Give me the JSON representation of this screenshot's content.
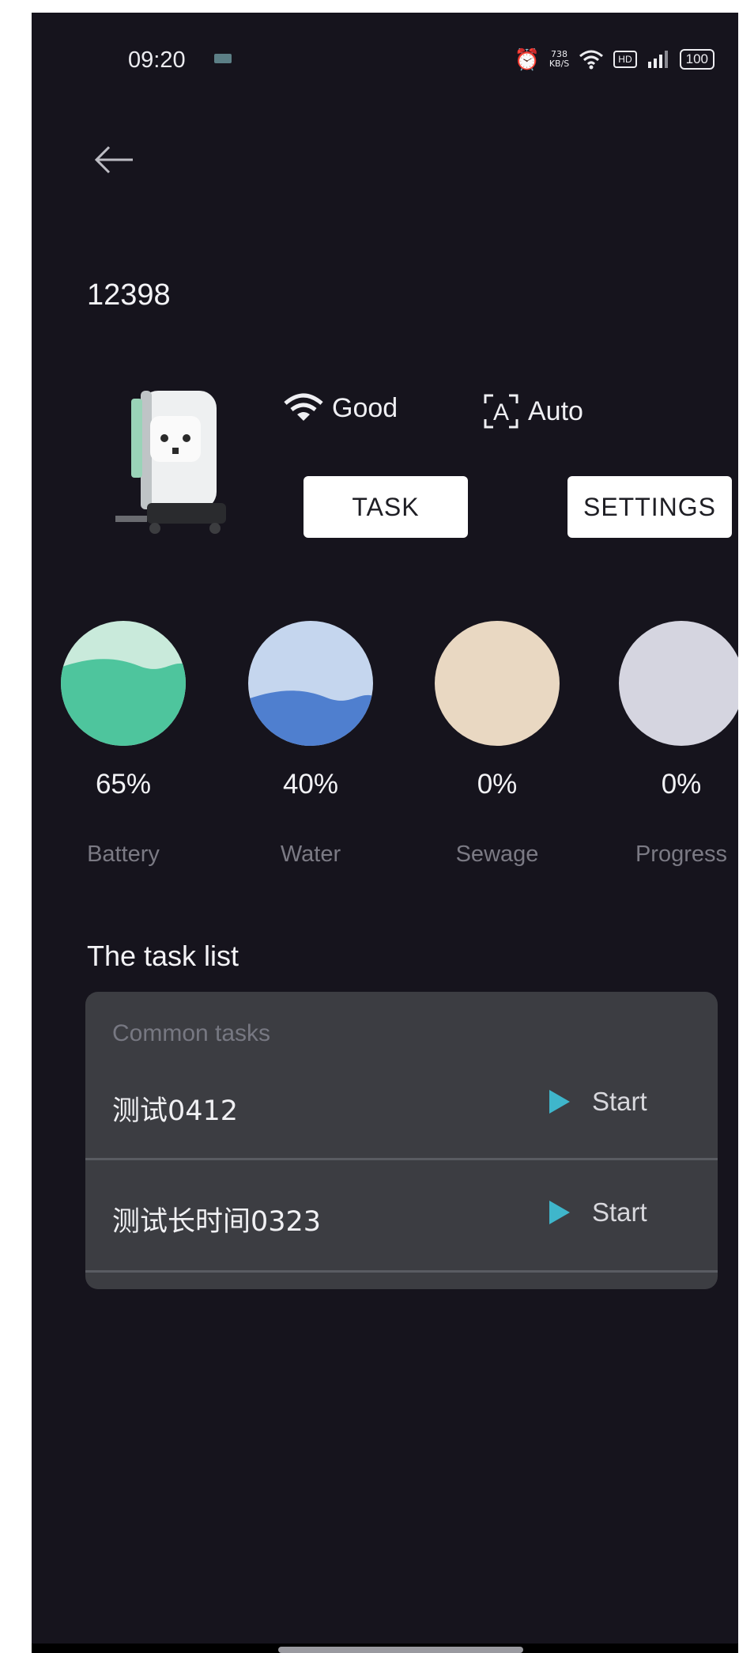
{
  "status_bar": {
    "time": "09:20",
    "speed_top": "738",
    "speed_bottom": "KB/S",
    "hd_label": "HD",
    "battery": "100"
  },
  "header": {
    "back_icon": "arrow-left-icon",
    "device_id": "12398"
  },
  "device": {
    "signal_label": "Good",
    "mode_label": "Auto",
    "task_button": "TASK",
    "settings_button": "SETTINGS"
  },
  "gauges": [
    {
      "value": "65%",
      "label": "Battery",
      "level": 0.65,
      "color": "#4ec59d",
      "light": "#c9eadb"
    },
    {
      "value": "40%",
      "label": "Water",
      "level": 0.4,
      "color": "#4f7fcf",
      "light": "#c5d6ee"
    },
    {
      "value": "0%",
      "label": "Sewage",
      "level": 0,
      "color": "#e9d8c2",
      "light": "#e9d8c2"
    },
    {
      "value": "0%",
      "label": "Progress",
      "level": 0,
      "color": "#d5d5e0",
      "light": "#d5d5e0"
    }
  ],
  "task_list": {
    "title": "The task list",
    "section_header": "Common tasks",
    "tasks": [
      {
        "name": "测试0412",
        "action": "Start"
      },
      {
        "name": "测试长时间0323",
        "action": "Start"
      }
    ]
  },
  "colors": {
    "background": "#16141d",
    "card": "#3c3d42",
    "play_accent": "#3fb6cb"
  }
}
